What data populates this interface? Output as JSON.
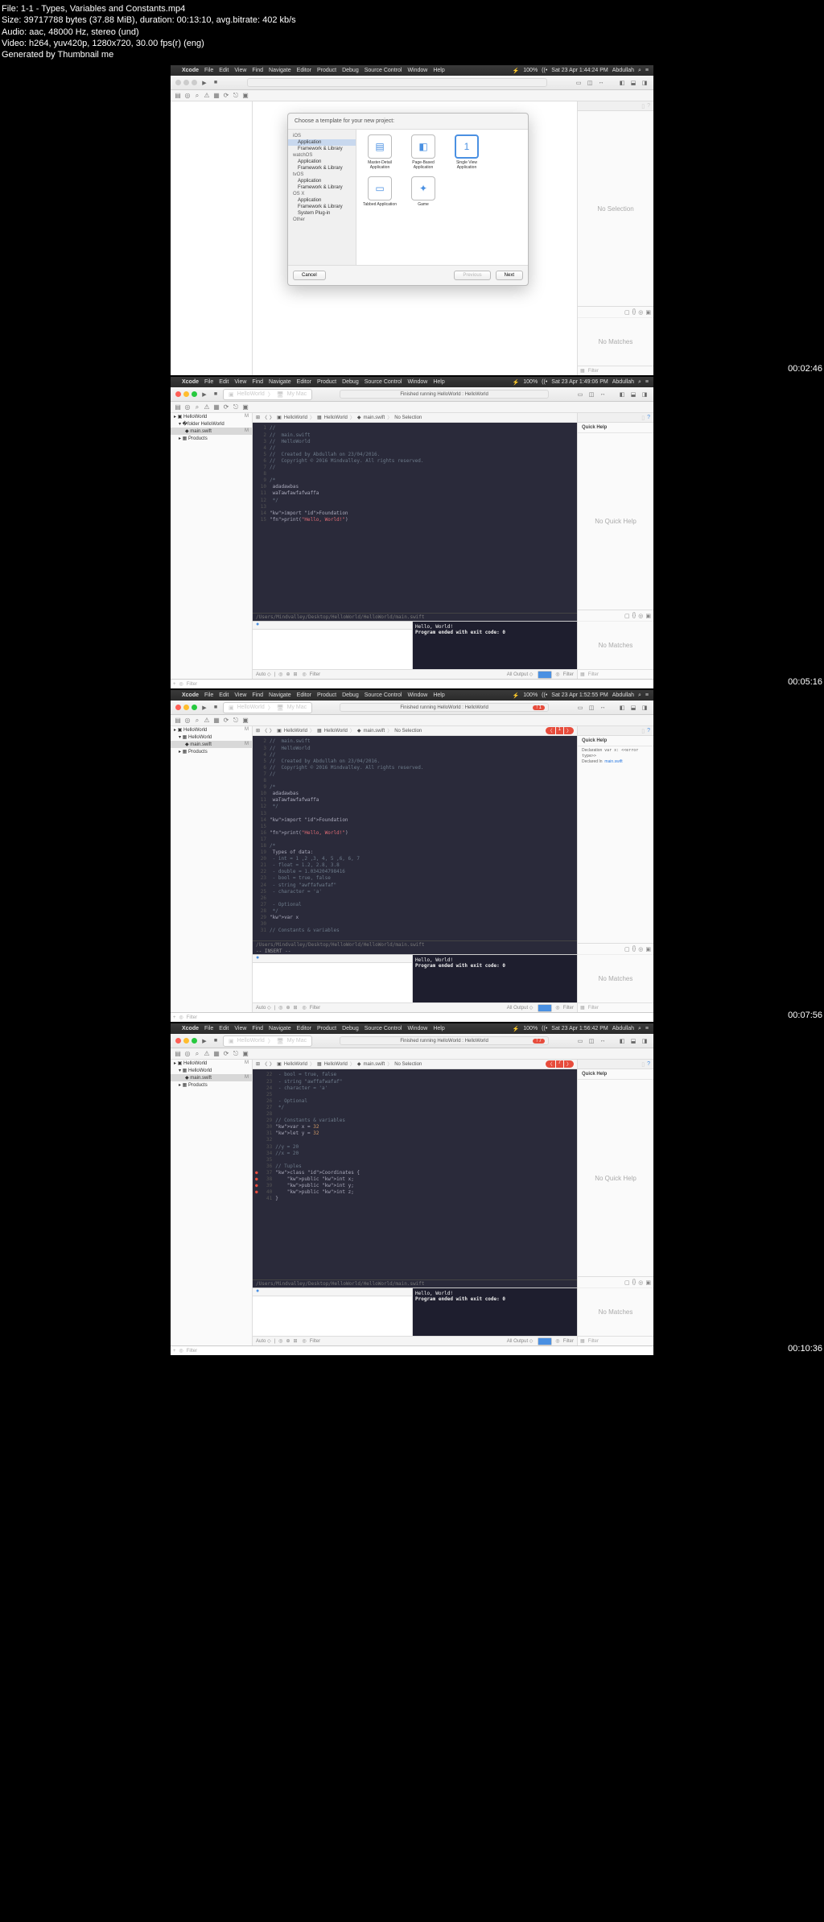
{
  "video_info": {
    "file": "File: 1-1 - Types, Variables and Constants.mp4",
    "size": "Size: 39717788 bytes (37.88 MiB), duration: 00:13:10, avg.bitrate: 402 kb/s",
    "audio": "Audio: aac, 48000 Hz, stereo (und)",
    "video": "Video: h264, yuv420p, 1280x720, 30.00 fps(r) (eng)",
    "gen": "Generated by Thumbnail me"
  },
  "menubar": {
    "items": [
      "Xcode",
      "File",
      "Edit",
      "View",
      "Find",
      "Navigate",
      "Editor",
      "Product",
      "Debug",
      "Source Control",
      "Window",
      "Help"
    ],
    "battery": "100%",
    "user": "Abdullah"
  },
  "times": [
    "Sat 23 Apr  1:44:24 PM",
    "Sat 23 Apr  1:49:06 PM",
    "Sat 23 Apr  1:52:55 PM",
    "Sat 23 Apr  1:56:42 PM"
  ],
  "timestamps": [
    "00:02:46",
    "00:05:16",
    "00:07:56",
    "00:10:36"
  ],
  "right_pane": {
    "no_selection": "No Selection",
    "no_matches": "No Matches",
    "quick_help": "Quick Help",
    "no_quick_help": "No Quick Help",
    "decl_label": "Declaration",
    "decl_value": "var x: <<error type>>",
    "declared_label": "Declared In",
    "declared_value": "main.swift"
  },
  "sheet": {
    "title": "Choose a template for your new project:",
    "side": {
      "iOS": [
        "Application",
        "Framework & Library"
      ],
      "watchOS": [
        "Application",
        "Framework & Library"
      ],
      "tvOS": [
        "Application",
        "Framework & Library"
      ],
      "OS X": [
        "Application",
        "Framework & Library",
        "System Plug-in"
      ],
      "Other": []
    },
    "templates": [
      {
        "name": "Master-Detail Application",
        "icon": "▤"
      },
      {
        "name": "Page-Based Application",
        "icon": "◧"
      },
      {
        "name": "Single View Application",
        "icon": "1"
      },
      {
        "name": "Tabbed Application",
        "icon": "▭"
      },
      {
        "name": "Game",
        "icon": "✦"
      }
    ],
    "cancel": "Cancel",
    "previous": "Previous",
    "next": "Next"
  },
  "scheme": {
    "proj": "HelloWorld",
    "dest": "My Mac"
  },
  "status": {
    "finished": "Finished running HelloWorld : HelloWorld",
    "err1": "1",
    "err7": "7"
  },
  "nav": {
    "proj": "HelloWorld",
    "folder": "HelloWorld",
    "file": "main.swift",
    "m": "M",
    "products": "Products"
  },
  "jump": {
    "p1": "HelloWorld",
    "p2": "HelloWorld",
    "p3": "main.swift",
    "p4": "No Selection"
  },
  "editor_path": "/Users/Mindvalley/Desktop/HelloWorld/HelloWorld/main.swift",
  "insert": "-- INSERT --",
  "console": {
    "line1": "Hello, World!",
    "line2": "Program ended with exit code: 0"
  },
  "debug_foot": {
    "auto": "Auto ◇",
    "filter": "Filter",
    "all_output": "All Output ◇"
  },
  "code1": "//\n//  main.swift\n//  HelloWorld\n//\n//  Created by Abdullah on 23/04/2016.\n//  Copyright © 2016 Mindvalley. All rights reserved.\n//\n\n/*\n adadawbas\n waTawfawfafwaffa\n */\n\nimport Foundation\nprint(\"Hello, World!\")",
  "code2": "//  main.swift\n//  HelloWorld\n//\n//  Created by Abdullah on 23/04/2016.\n//  Copyright © 2016 Mindvalley. All rights reserved.\n//\n\n/*\n adadawbas\n waTawfawfafwaffa\n */\n\nimport Foundation\n\nprint(\"Hello, World!\")\n\n/*\n Types of data:\n - int = 1 ,2 ,3, 4, 5 ,6, 6, 7\n - float = 1.2, 2.8, 3.8\n - double = 1.034204798416\n - bool = true, false\n - string \"awffafwafaf\"\n - character = 'a'\n\n - Optional\n */\nvar x\n\n// Constants & variables",
  "code3": " - bool = true, false\n - string \"awffafwafaf\"\n - character = 'a'\n\n - Optional\n */\n\n// Constants & variables\nvar x = 32\nlet y = 32\n\n//y = 20\n//x = 20\n\n// Tuples\nclass Coordinates {\n    public int x;\n    public int y;\n    public int z;\n}"
}
